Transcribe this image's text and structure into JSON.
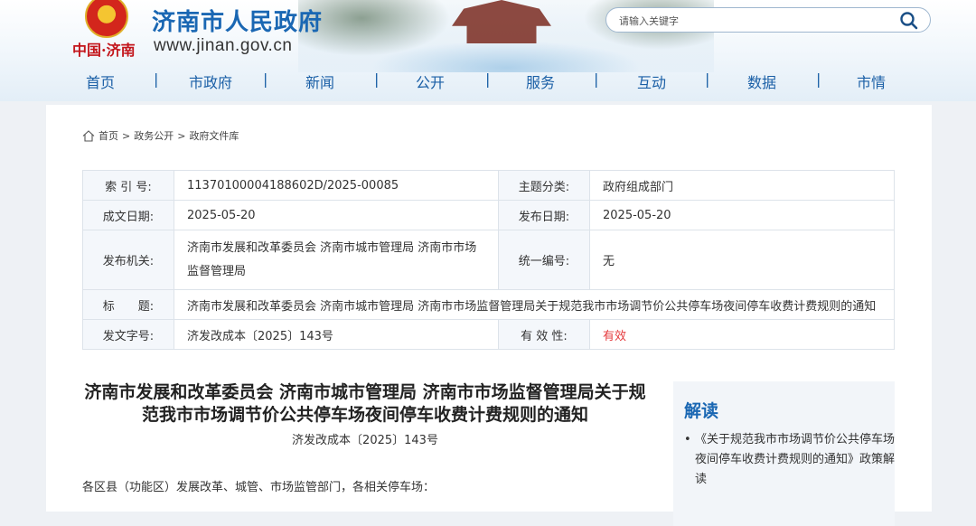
{
  "header": {
    "site_title": "济南市人民政府",
    "logo_text": "中国·济南",
    "site_url": "www.jinan.gov.cn",
    "search_placeholder": "请输入关键字"
  },
  "nav": [
    "首页",
    "市政府",
    "新闻",
    "公开",
    "服务",
    "互动",
    "数据",
    "市情"
  ],
  "nav_separator": "|",
  "breadcrumb": [
    "首页",
    "政务公开",
    "政府文件库"
  ],
  "breadcrumb_separator": ">",
  "meta": {
    "index_label": "索 引 号:",
    "index_value": "11370100004188602D/2025-00085",
    "topic_label": "主题分类:",
    "topic_value": "政府组成部门",
    "date_label": "成文日期:",
    "date_value": "2025-05-20",
    "pubdate_label": "发布日期:",
    "pubdate_value": "2025-05-20",
    "issuer_label": "发布机关:",
    "issuer_value": "济南市发展和改革委员会 济南市城市管理局 济南市市场监督管理局",
    "unified_label": "统一编号:",
    "unified_value": "无",
    "title_label": "标　　题:",
    "title_value": "济南市发展和改革委员会 济南市城市管理局 济南市市场监督管理局关于规范我市市场调节价公共停车场夜间停车收费计费规则的通知",
    "docno_label": "发文字号:",
    "docno_value": "济发改成本〔2025〕143号",
    "validity_label": "有 效 性:",
    "validity_value": "有效",
    "validity_color": "#e4393c"
  },
  "document": {
    "title": "济南市发展和改革委员会 济南市城市管理局 济南市市场监督管理局关于规范我市市场调节价公共停车场夜间停车收费计费规则的通知",
    "doc_number": "济发改成本〔2025〕143号",
    "salutation": "各区县（功能区）发展改革、城管、市场监管部门，各相关停车场："
  },
  "sidebar": {
    "title": "解读",
    "items": [
      "《关于规范我市市场调节价公共停车场夜间停车收费计费规则的通知》政策解读"
    ]
  },
  "colors": {
    "brand_blue": "#1a67b3",
    "nav_blue": "#1a5fa6",
    "red": "#c3161c"
  }
}
